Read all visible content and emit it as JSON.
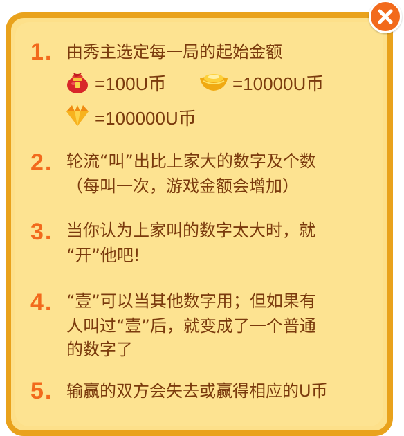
{
  "rules": [
    {
      "number": "1.",
      "lines": [
        "由秀主选定每一局的起始金额"
      ]
    },
    {
      "number": "2.",
      "lines": [
        "轮流“叫”出比上家大的数字及个数",
        "（每叫一次，游戏金额会增加）"
      ]
    },
    {
      "number": "3.",
      "lines": [
        "当你认为上家叫的数字太大时，就",
        "“开”他吧!"
      ]
    },
    {
      "number": "4.",
      "lines": [
        "“壹”可以当其他数字用；但如果有",
        "人叫过“壹”后，就变成了一个普通",
        "的数字了"
      ]
    },
    {
      "number": "5.",
      "lines": [
        "输赢的双方会失去或赢得相应的U币"
      ]
    }
  ],
  "currency": {
    "bag": "=100U币",
    "ingot": "=10000U币",
    "diamond": "=100000U币"
  },
  "icons": {
    "bag": "money-bag-icon",
    "ingot": "gold-ingot-icon",
    "diamond": "diamond-icon",
    "close": "close-icon"
  },
  "colors": {
    "panel": "#fde08a",
    "border": "#e9a21c",
    "number": "#f26a1c",
    "text": "#7a3a0d",
    "close": "#f26a1c"
  }
}
